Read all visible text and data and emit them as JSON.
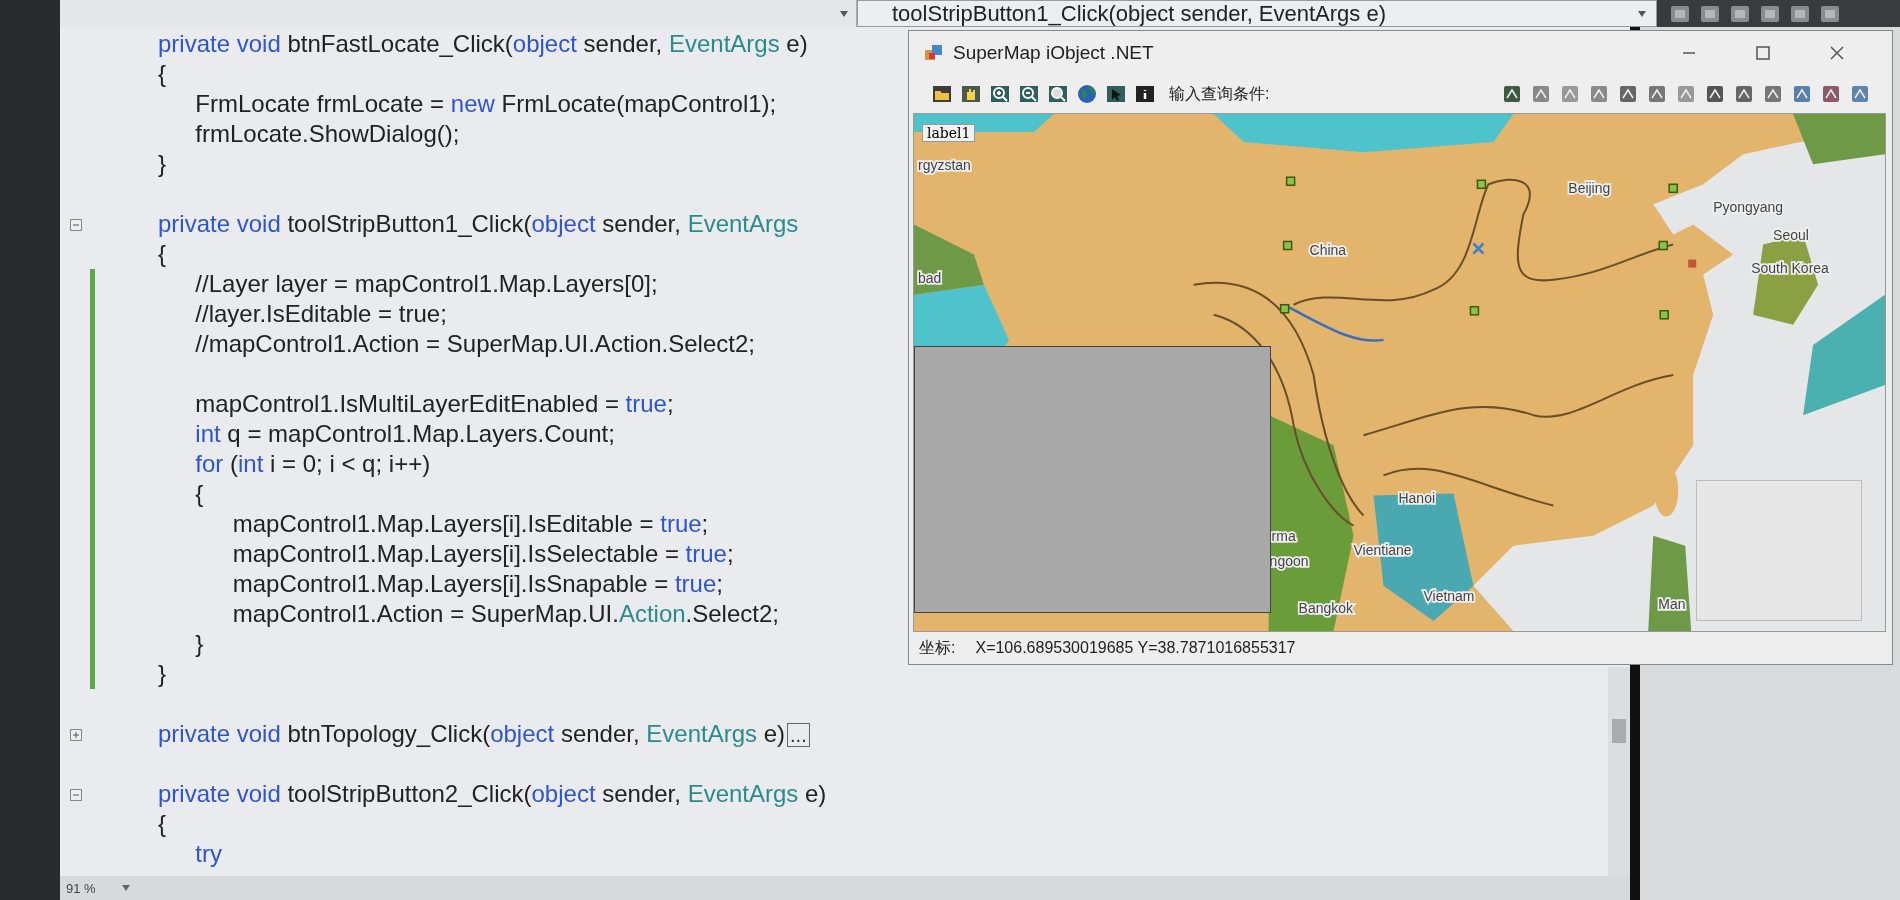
{
  "editor": {
    "navigation_dropdown": {
      "value": "toolStripButton1_Click(object sender, EventArgs e)"
    },
    "code_lines": [
      {
        "changed": false,
        "tokens": [
          {
            "kind": "keyword",
            "text": "private void"
          },
          {
            "kind": "plain",
            "text": " btnFastLocate_Click("
          },
          {
            "kind": "keyword",
            "text": "object"
          },
          {
            "kind": "plain",
            "text": " sender, "
          },
          {
            "kind": "type",
            "text": "EventArgs"
          },
          {
            "kind": "plain",
            "text": " e)"
          }
        ]
      },
      {
        "changed": false,
        "tokens": [
          {
            "kind": "plain",
            "text": "{"
          }
        ]
      },
      {
        "changed": false,
        "tokens": [
          {
            "kind": "plain",
            "text": "\tFrmLocate frmLocate = "
          },
          {
            "kind": "keyword",
            "text": "new"
          },
          {
            "kind": "plain",
            "text": " FrmLocate(mapControl1);"
          }
        ]
      },
      {
        "changed": false,
        "tokens": [
          {
            "kind": "plain",
            "text": "\tfrmLocate.ShowDialog();"
          }
        ]
      },
      {
        "changed": false,
        "tokens": [
          {
            "kind": "plain",
            "text": "}"
          }
        ]
      },
      {
        "changed": false
      },
      {
        "changed": false,
        "expanded": true,
        "tokens": [
          {
            "kind": "keyword",
            "text": "private void"
          },
          {
            "kind": "plain",
            "text": " toolStripButton1_Click("
          },
          {
            "kind": "keyword",
            "text": "object"
          },
          {
            "kind": "plain",
            "text": " sender, "
          },
          {
            "kind": "type",
            "text": "EventArgs"
          }
        ]
      },
      {
        "changed": false,
        "tokens": [
          {
            "kind": "plain",
            "text": "{"
          }
        ]
      },
      {
        "changed": true,
        "tokens": [
          {
            "kind": "plain",
            "text": "\t//Layer layer = mapControl1.Map.Layers[0];"
          }
        ]
      },
      {
        "changed": true,
        "tokens": [
          {
            "kind": "plain",
            "text": "\t//layer.IsEditable = true;"
          }
        ]
      },
      {
        "changed": true,
        "tokens": [
          {
            "kind": "plain",
            "text": "\t//mapControl1.Action = SuperMap.UI.Action.Select2;"
          }
        ]
      },
      {
        "changed": true
      },
      {
        "changed": true,
        "tokens": [
          {
            "kind": "plain",
            "text": "\tmapControl1.IsMultiLayerEditEnabled = "
          },
          {
            "kind": "keyword",
            "text": "true"
          },
          {
            "kind": "plain",
            "text": ";"
          }
        ]
      },
      {
        "changed": true,
        "tokens": [
          {
            "kind": "keyword",
            "text": "\tint"
          },
          {
            "kind": "plain",
            "text": " q = mapControl1.Map.Layers.Count;"
          }
        ]
      },
      {
        "changed": true,
        "tokens": [
          {
            "kind": "keyword",
            "text": "\tfor"
          },
          {
            "kind": "plain",
            "text": " ("
          },
          {
            "kind": "keyword",
            "text": "int"
          },
          {
            "kind": "plain",
            "text": " i = 0; i < q; i++)"
          }
        ]
      },
      {
        "changed": true,
        "tokens": [
          {
            "kind": "plain",
            "text": "\t{"
          }
        ]
      },
      {
        "changed": true,
        "tokens": [
          {
            "kind": "plain",
            "text": "\t\tmapControl1.Map.Layers[i].IsEditable = "
          },
          {
            "kind": "keyword",
            "text": "true"
          },
          {
            "kind": "plain",
            "text": ";"
          }
        ]
      },
      {
        "changed": true,
        "tokens": [
          {
            "kind": "plain",
            "text": "\t\tmapControl1.Map.Layers[i].IsSelectable = "
          },
          {
            "kind": "keyword",
            "text": "true"
          },
          {
            "kind": "plain",
            "text": ";"
          }
        ]
      },
      {
        "changed": true,
        "tokens": [
          {
            "kind": "plain",
            "text": "\t\tmapControl1.Map.Layers[i].IsSnapable = "
          },
          {
            "kind": "keyword",
            "text": "true"
          },
          {
            "kind": "plain",
            "text": ";"
          }
        ]
      },
      {
        "changed": true,
        "tokens": [
          {
            "kind": "plain",
            "text": "\t\tmapControl1.Action = SuperMap.UI."
          },
          {
            "kind": "type",
            "text": "Action"
          },
          {
            "kind": "plain",
            "text": ".Select2;"
          }
        ]
      },
      {
        "changed": true,
        "tokens": [
          {
            "kind": "plain",
            "text": "\t}"
          }
        ]
      },
      {
        "changed": true,
        "tokens": [
          {
            "kind": "plain",
            "text": "}"
          }
        ]
      },
      {
        "changed": false
      },
      {
        "changed": false,
        "expanded": false,
        "tokens": [
          {
            "kind": "keyword",
            "text": "private void"
          },
          {
            "kind": "plain",
            "text": " btnTopology_Click("
          },
          {
            "kind": "keyword",
            "text": "object"
          },
          {
            "kind": "plain",
            "text": " sender, "
          },
          {
            "kind": "type",
            "text": "EventArgs"
          },
          {
            "kind": "plain",
            "text": " e)"
          },
          {
            "kind": "collapsed",
            "text": "..."
          }
        ]
      },
      {
        "changed": false
      },
      {
        "changed": false,
        "expanded": true,
        "tokens": [
          {
            "kind": "keyword",
            "text": "private void"
          },
          {
            "kind": "plain",
            "text": " toolStripButton2_Click("
          },
          {
            "kind": "keyword",
            "text": "object"
          },
          {
            "kind": "plain",
            "text": " sender, "
          },
          {
            "kind": "type",
            "text": "EventArgs"
          },
          {
            "kind": "plain",
            "text": " e)"
          }
        ]
      },
      {
        "changed": false,
        "tokens": [
          {
            "kind": "plain",
            "text": "{"
          }
        ]
      },
      {
        "changed": false,
        "tokens": [
          {
            "kind": "keyword",
            "text": "\ttry"
          }
        ]
      }
    ],
    "zoom_level": "91 %"
  },
  "map_window": {
    "title": "SuperMap iObject .NET",
    "toolbar": {
      "query_label": "输入查询条件:"
    },
    "map": {
      "overlay_label": "label1",
      "place_labels": [
        "rgyzstan",
        "bad",
        "China",
        "Beijing",
        "Pyongyang",
        "Seoul",
        "South Korea",
        "Hanoi",
        "Vientiane",
        "rma",
        "ngoon",
        "Vietnam",
        "Bangkok",
        "Man"
      ]
    },
    "status_bar": {
      "label": "坐标:",
      "coordinates": "X=106.689530019685 Y=38.7871016855317"
    }
  }
}
